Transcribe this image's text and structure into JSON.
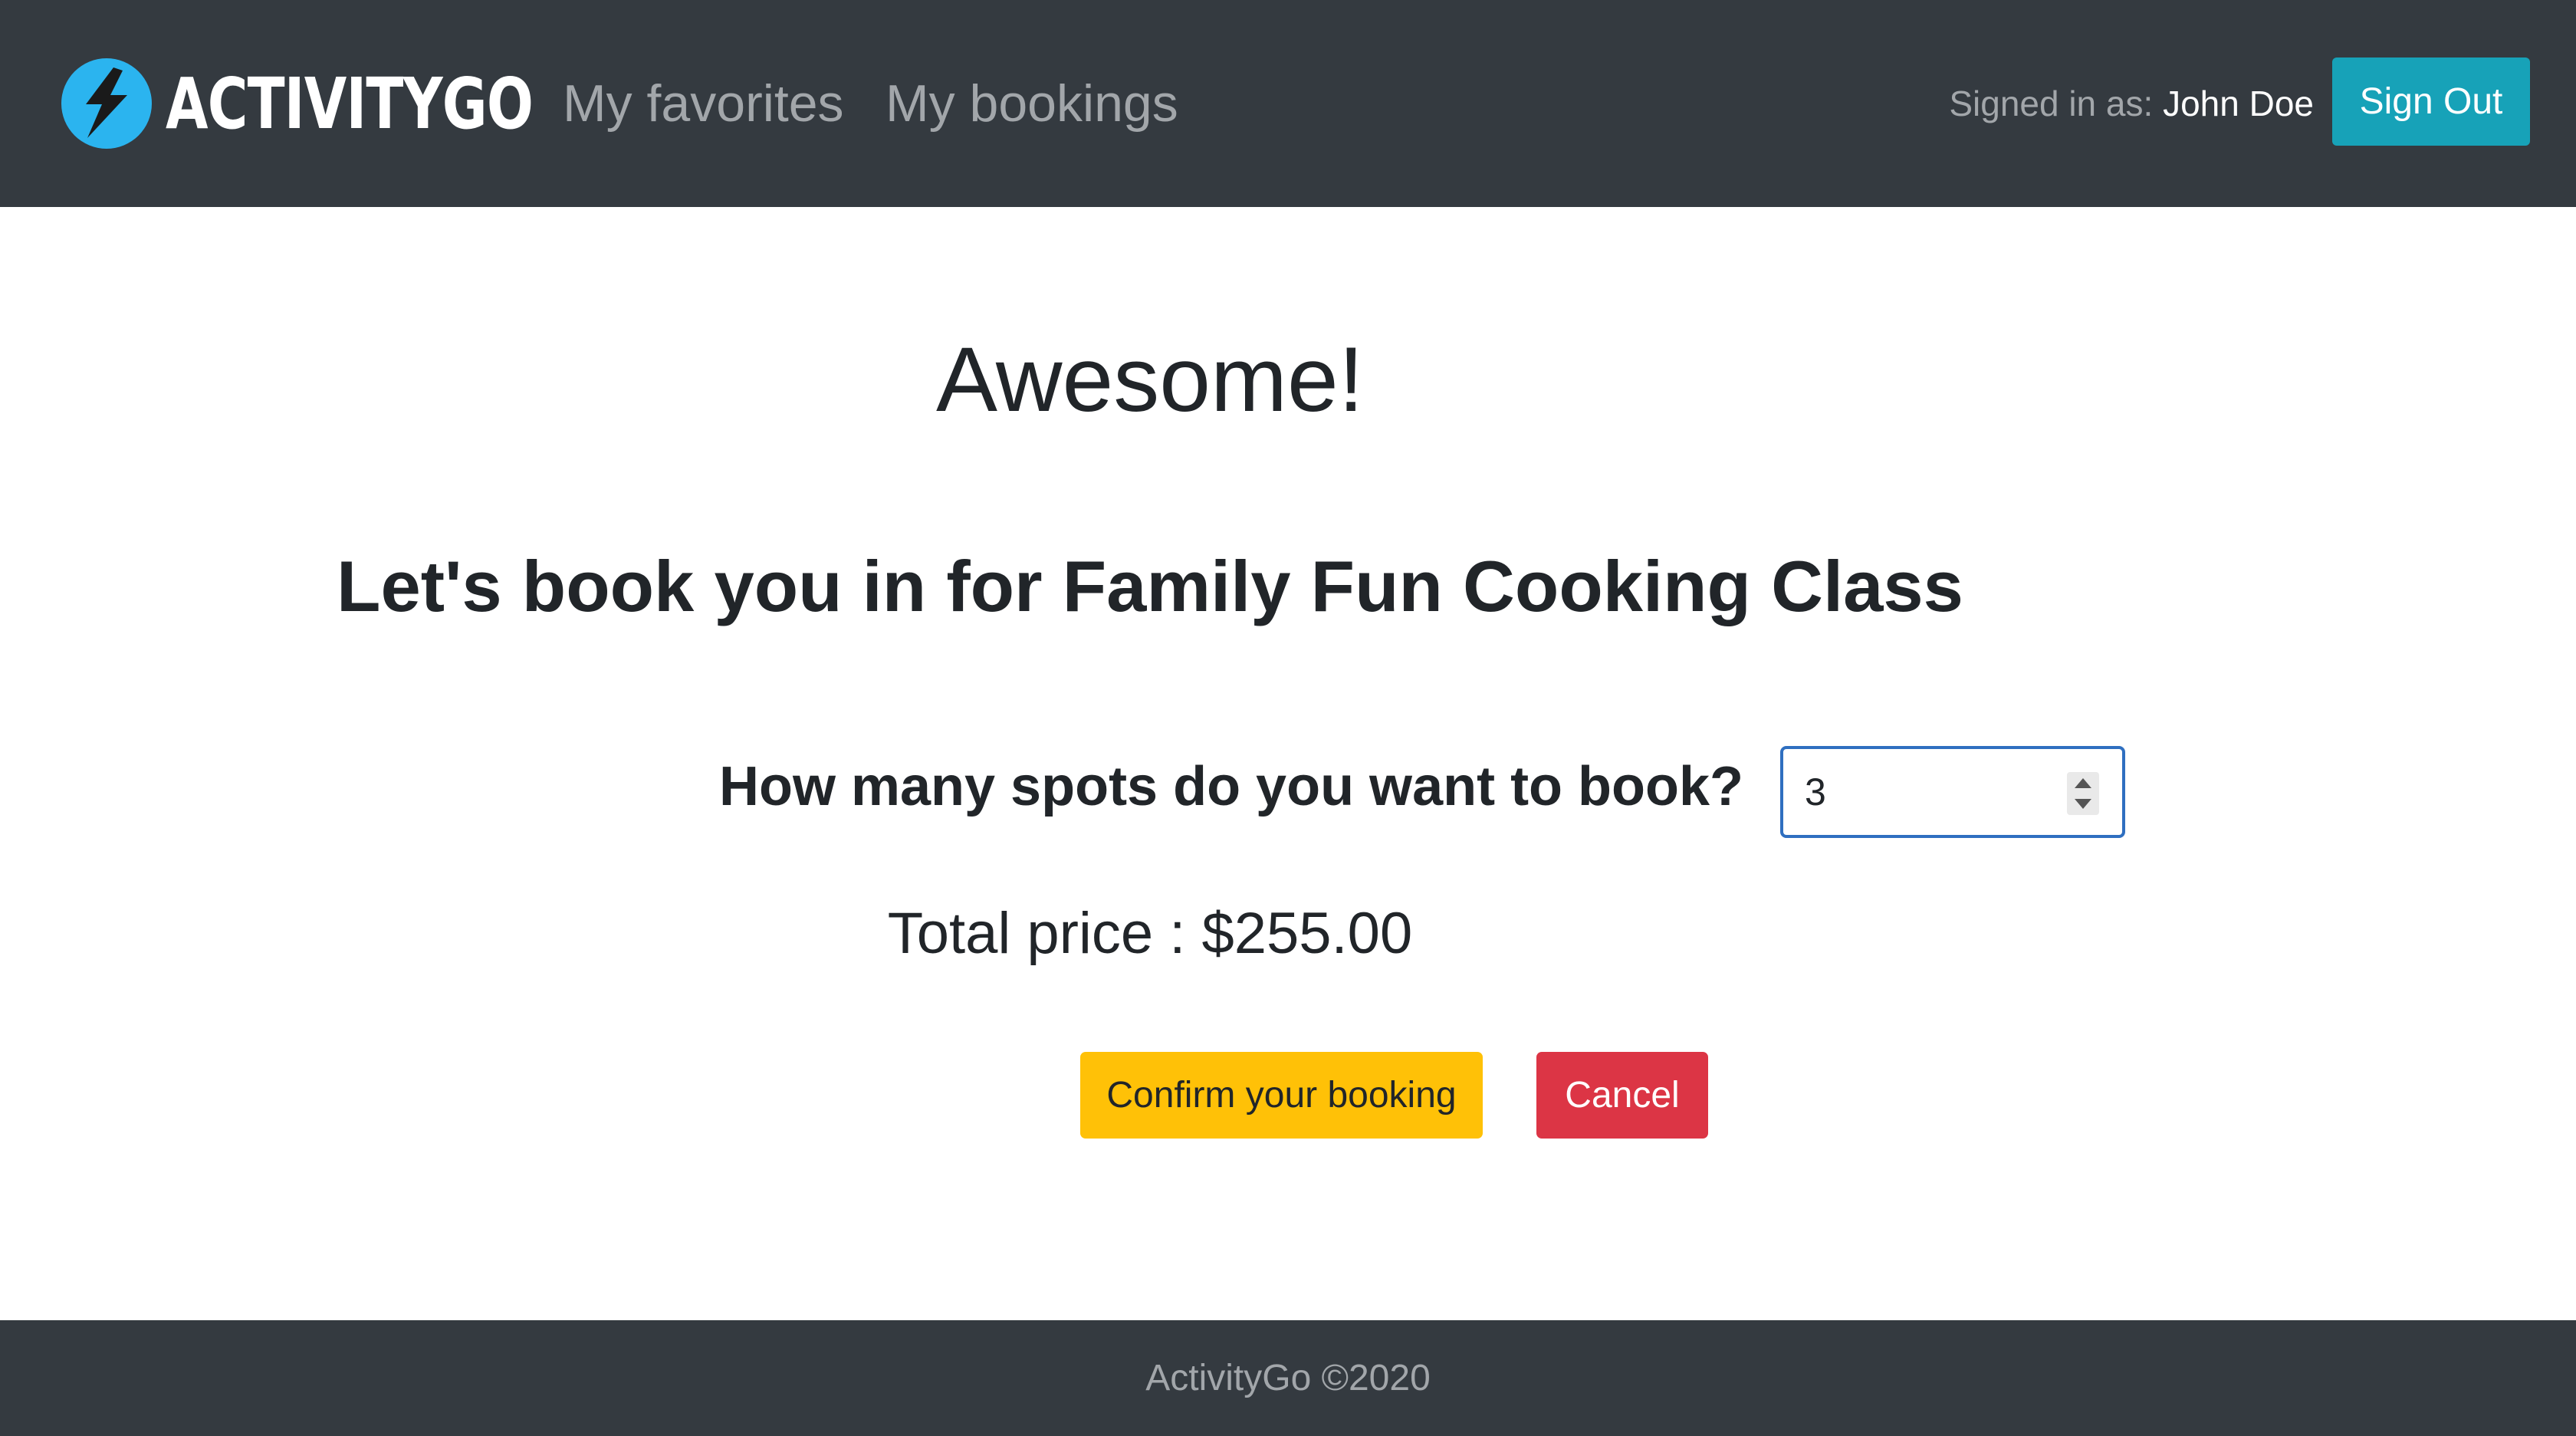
{
  "header": {
    "brand": "ACTIVITYGO",
    "logo_icon": "lightning-bolt-icon",
    "nav": [
      {
        "label": "My favorites"
      },
      {
        "label": "My bookings"
      }
    ],
    "signed_in_prefix": "Signed in as:",
    "user_name": "John Doe",
    "sign_out_label": "Sign Out"
  },
  "main": {
    "headline": "Awesome!",
    "subheadline": "Let's book you in for Family Fun Cooking Class",
    "spots_question": "How many spots do you want to book?",
    "spots_value": "3",
    "total_price": "Total price : $255.00",
    "confirm_label": "Confirm your booking",
    "cancel_label": "Cancel"
  },
  "footer": {
    "text": "ActivityGo ©2020"
  },
  "colors": {
    "navbar": "#343a40",
    "logo_circle": "#2bb4ef",
    "sign_out": "#17a2b8",
    "confirm": "#ffc107",
    "cancel": "#dc3545",
    "input_focus_border": "#2f6fc0"
  }
}
